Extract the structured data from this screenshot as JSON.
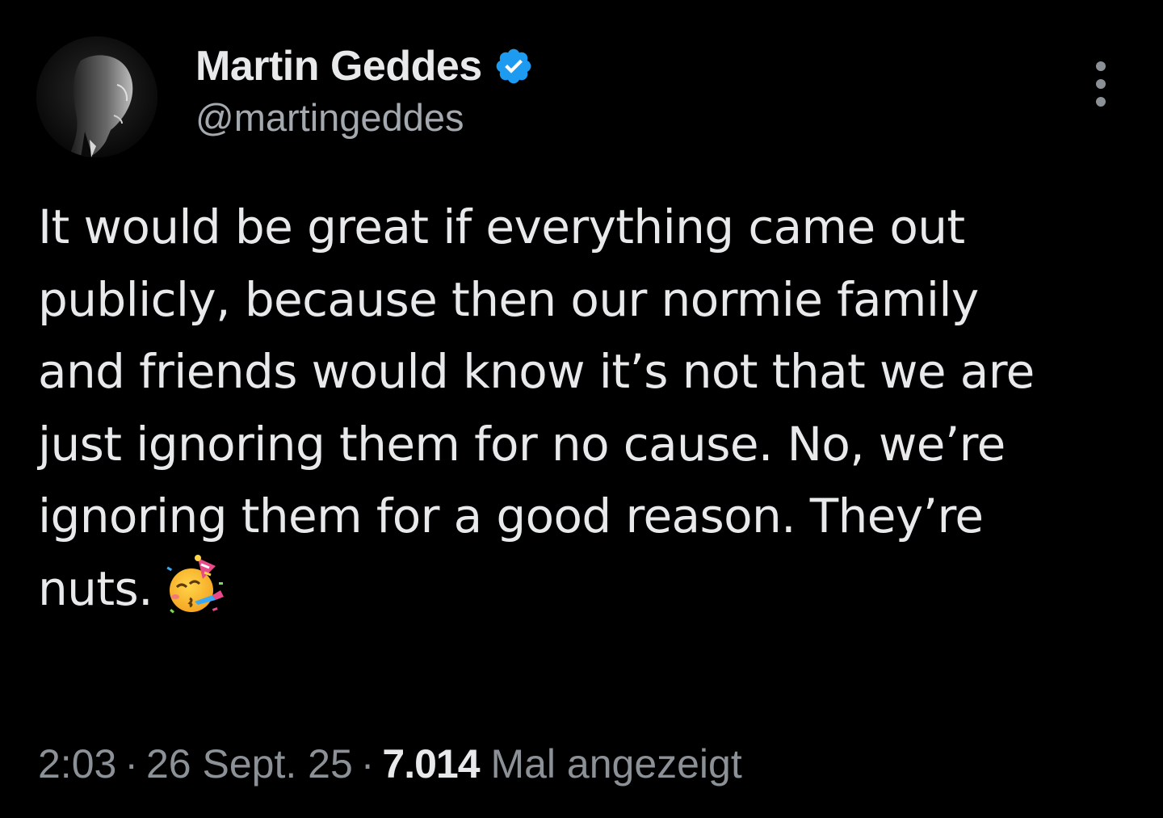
{
  "author": {
    "display_name": "Martin Geddes",
    "handle": "@martingeddes",
    "verified": true,
    "verified_color": "#1d9bf0"
  },
  "tweet": {
    "text_lines": [
      "It would be great if everything came out",
      "publicly, because then our normie family",
      "and friends would know it’s not that we are",
      "just ignoring them for no cause. No, we’re",
      "ignoring them for a good reason. They’re",
      "nuts."
    ],
    "emoji": "partying-face"
  },
  "meta": {
    "time": "2:03",
    "separator": "·",
    "date": "26 Sept. 25",
    "views_count": "7.014",
    "views_label": "Mal angezeigt"
  },
  "icons": {
    "more": "more-vertical-icon",
    "verified": "verified-badge-icon"
  },
  "colors": {
    "background": "#000000",
    "primary_text": "#e7e9ea",
    "secondary_text": "#8b9196"
  }
}
